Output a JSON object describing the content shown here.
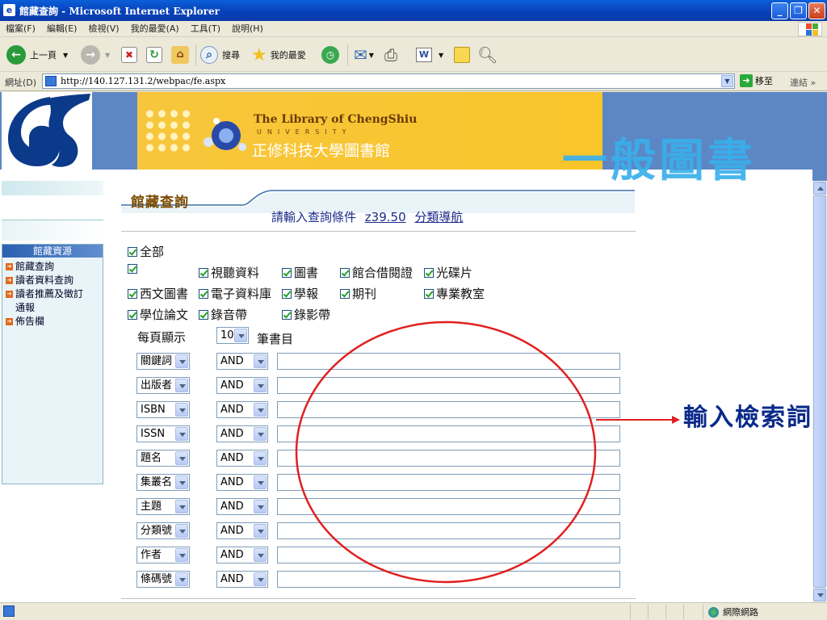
{
  "window": {
    "title": "館藏查詢 - Microsoft Internet Explorer"
  },
  "menu": [
    "檔案(F)",
    "編輯(E)",
    "檢視(V)",
    "我的最愛(A)",
    "工具(T)",
    "說明(H)"
  ],
  "toolbar": {
    "back_label": "上一頁",
    "search_label": "搜尋",
    "favorites_label": "我的最愛"
  },
  "address": {
    "label": "網址(D)",
    "url": "http://140.127.131.2/webpac/fe.aspx",
    "go_label": "移至",
    "links_label": "連結"
  },
  "banner": {
    "english_title": "The Library of ChengShiu",
    "university_word": "UNIVERSITY",
    "chinese_title": "正修科技大學圖書館",
    "overlay_title": "一般圖書"
  },
  "sidebar": {
    "heading": "館藏資源",
    "items": [
      {
        "label": "館藏查詢"
      },
      {
        "label": "讀者資料查詢"
      },
      {
        "label": "讀者推薦及徵訂通報"
      },
      {
        "label": "佈告欄"
      }
    ]
  },
  "form": {
    "panel_title": "館藏查詢",
    "hint": "請輸入查詢條件",
    "link_z3950": "z39.50",
    "link_classification": "分類導航",
    "checkboxes": {
      "all": "全部",
      "av": "視聽資料",
      "books": "圖書",
      "ill": "館合借閱證",
      "cd": "光碟片",
      "western": "西文圖書",
      "edb": "電子資料庫",
      "journal_school": "學報",
      "periodical": "期刊",
      "classroom": "專業教室",
      "thesis": "學位論文",
      "tape": "錄音帶",
      "video": "錄影帶"
    },
    "per_page_label": "每頁顯示",
    "per_page_value": "10",
    "per_page_suffix": "筆書目",
    "rows": [
      {
        "field": "關鍵詞",
        "op": "AND"
      },
      {
        "field": "出版者",
        "op": "AND"
      },
      {
        "field": "ISBN",
        "op": "AND"
      },
      {
        "field": "ISSN",
        "op": "AND"
      },
      {
        "field": "題名",
        "op": "AND"
      },
      {
        "field": "集叢名",
        "op": "AND"
      },
      {
        "field": "主題",
        "op": "AND"
      },
      {
        "field": "分類號",
        "op": "AND"
      },
      {
        "field": "作者",
        "op": "AND"
      },
      {
        "field": "條碼號",
        "op": "AND"
      }
    ]
  },
  "annotation": {
    "label": "輸入檢索詞",
    "color": "#e02020"
  },
  "status": {
    "zone": "網際網路"
  }
}
